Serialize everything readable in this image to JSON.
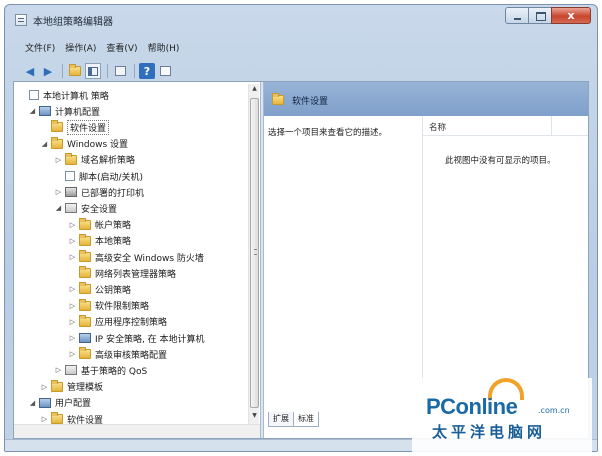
{
  "window": {
    "title": "本地组策略编辑器",
    "close_glyph": "x"
  },
  "menu": [
    "文件(F)",
    "操作(A)",
    "查看(V)",
    "帮助(H)"
  ],
  "toolbar": {
    "back": "◀",
    "forward": "▶",
    "help": "?"
  },
  "tree": [
    {
      "label": "本地计算机 策略",
      "icon": "sheet-icon",
      "twisty": ""
    },
    {
      "label": "计算机配置",
      "icon": "computer-icon",
      "twisty": "◢"
    },
    {
      "label": "软件设置",
      "icon": "folder-icon",
      "twisty": ""
    },
    {
      "label": "Windows 设置",
      "icon": "folder-icon",
      "twisty": "◢"
    },
    {
      "label": "域名解析策略",
      "icon": "folder-icon",
      "twisty": "▷"
    },
    {
      "label": "脚本(启动/关机)",
      "icon": "script-icon",
      "twisty": ""
    },
    {
      "label": "已部署的打印机",
      "icon": "printer-icon",
      "twisty": "▷"
    },
    {
      "label": "安全设置",
      "icon": "security-icon",
      "twisty": "◢"
    },
    {
      "label": "帐户策略",
      "icon": "folder-icon",
      "twisty": "▷"
    },
    {
      "label": "本地策略",
      "icon": "folder-icon",
      "twisty": "▷"
    },
    {
      "label": "高级安全 Windows 防火墙",
      "icon": "folder-icon",
      "twisty": "▷"
    },
    {
      "label": "网络列表管理器策略",
      "icon": "folder-icon",
      "twisty": ""
    },
    {
      "label": "公钥策略",
      "icon": "folder-icon",
      "twisty": "▷"
    },
    {
      "label": "软件限制策略",
      "icon": "folder-icon",
      "twisty": "▷"
    },
    {
      "label": "应用程序控制策略",
      "icon": "folder-icon",
      "twisty": "▷"
    },
    {
      "label": "IP 安全策略, 在 本地计算机",
      "icon": "network-icon",
      "twisty": "▷"
    },
    {
      "label": "高级审核策略配置",
      "icon": "folder-icon",
      "twisty": "▷"
    },
    {
      "label": "基于策略的 QoS",
      "icon": "chart-icon",
      "twisty": "▷"
    },
    {
      "label": "管理模板",
      "icon": "folder-icon",
      "twisty": "▷"
    },
    {
      "label": "用户配置",
      "icon": "user-icon",
      "twisty": "◢"
    },
    {
      "label": "软件设置",
      "icon": "folder-icon",
      "twisty": "▷"
    }
  ],
  "right_pane": {
    "header_title": "软件设置",
    "description": "选择一个项目来查看它的描述。",
    "column_name": "名称",
    "empty_message": "此视图中没有可显示的项目。"
  },
  "tabs": [
    "扩展",
    "标准"
  ],
  "watermark": {
    "logo": "PConline",
    "dotcom": ".com.cn",
    "sub": "太平洋电脑网"
  },
  "colors": {
    "header_blue": "#8aa9d1",
    "folder_yellow": "#e6b43c",
    "watermark_blue": "#1a6aa6",
    "watermark_orange": "#f0a22a"
  }
}
